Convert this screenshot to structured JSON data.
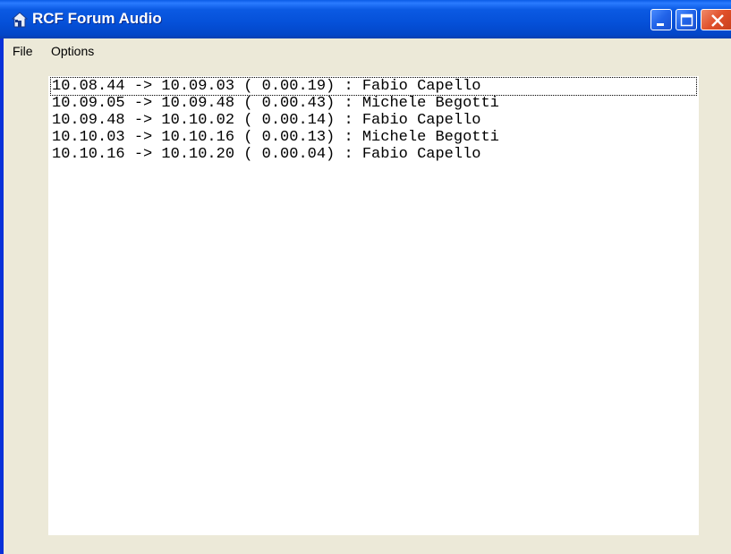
{
  "window": {
    "title": "RCF Forum Audio",
    "title_icon": "house-icon"
  },
  "menu": {
    "file": "File",
    "options": "Options"
  },
  "log": {
    "rows": [
      {
        "text": "10.08.44 -> 10.09.03 ( 0.00.19) : Fabio Capello"
      },
      {
        "text": "10.09.05 -> 10.09.48 ( 0.00.43) : Michele Begotti"
      },
      {
        "text": "10.09.48 -> 10.10.02 ( 0.00.14) : Fabio Capello"
      },
      {
        "text": "10.10.03 -> 10.10.16 ( 0.00.13) : Michele Begotti"
      },
      {
        "text": "10.10.16 -> 10.10.20 ( 0.00.04) : Fabio Capello"
      }
    ]
  },
  "colors": {
    "titlebar": "#0550d8",
    "close_button": "#e0502a",
    "background": "#ece9d8"
  }
}
